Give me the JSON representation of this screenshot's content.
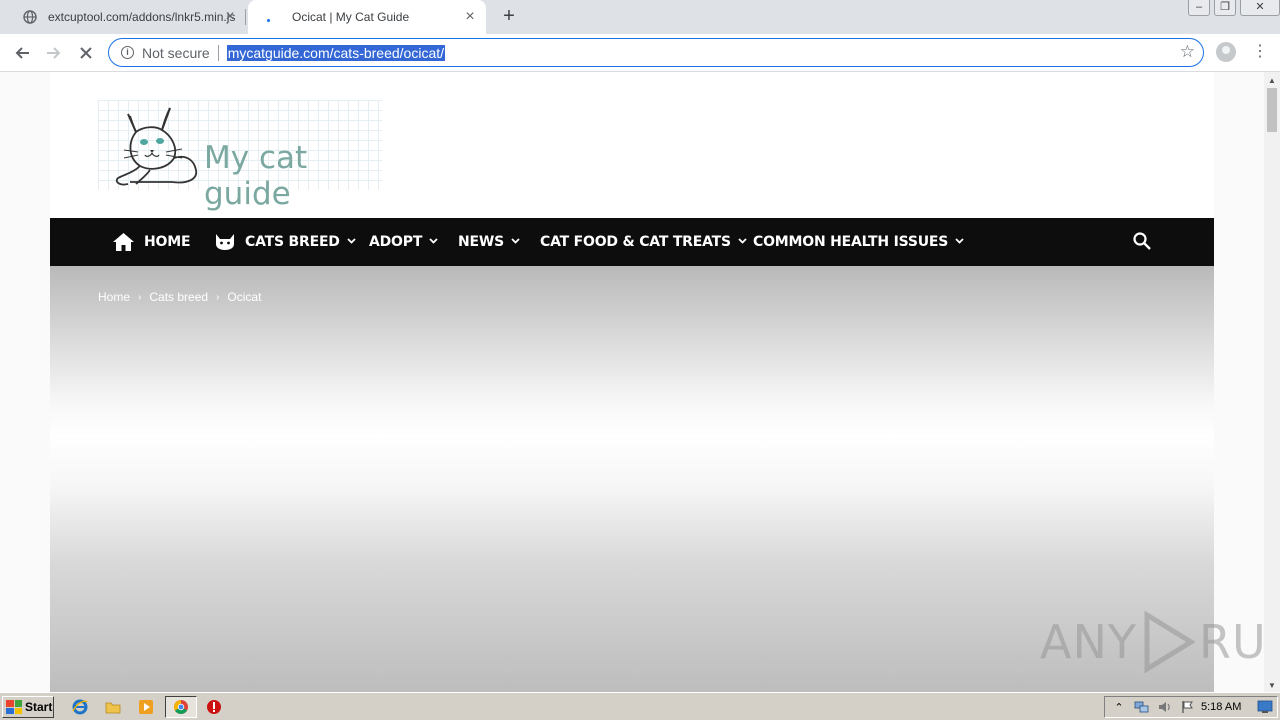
{
  "browser": {
    "tabs": [
      {
        "title": "extcuptool.com/addons/lnkr5.min.js",
        "active": false
      },
      {
        "title": "Ocicat | My Cat Guide",
        "active": true
      }
    ],
    "omnibox": {
      "security_label": "Not secure",
      "url": "mycatguide.com/cats-breed/ocicat/"
    }
  },
  "site": {
    "logo_text": "My cat guide",
    "nav": [
      {
        "label": "HOME",
        "icon": "home-icon"
      },
      {
        "label": "CATS BREED",
        "icon": "cat-icon",
        "dropdown": true
      },
      {
        "label": "ADOPT",
        "dropdown": true
      },
      {
        "label": "NEWS",
        "dropdown": true
      },
      {
        "label": "CAT FOOD & CAT TREATS",
        "dropdown": true
      },
      {
        "label": "COMMON HEALTH ISSUES",
        "dropdown": true
      }
    ],
    "breadcrumb": [
      "Home",
      "Cats breed",
      "Ocicat"
    ]
  },
  "watermark": {
    "left": "ANY",
    "right": "RUN"
  },
  "taskbar": {
    "start_label": "Start",
    "clock": "5:18 AM"
  },
  "colors": {
    "nav_bg": "#0d0d0d",
    "logo_text": "#7ba8a0",
    "url_highlight": "#3367d6",
    "focus_ring": "#1a73e8"
  }
}
